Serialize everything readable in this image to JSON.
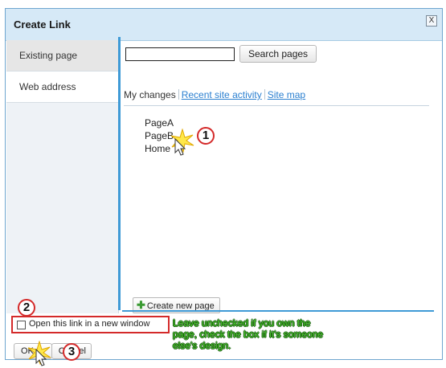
{
  "dialog": {
    "title": "Create Link",
    "close_label": "X"
  },
  "sidebar": {
    "items": [
      {
        "label": "Existing page"
      },
      {
        "label": "Web address"
      }
    ]
  },
  "search": {
    "input_value": "",
    "button_label": "Search pages"
  },
  "tabs": [
    {
      "label": "My changes"
    },
    {
      "label": "Recent site activity"
    },
    {
      "label": "Site map"
    }
  ],
  "pages": [
    {
      "label": "PageA"
    },
    {
      "label": "PageB"
    },
    {
      "label": "Home"
    }
  ],
  "create_page_label": "Create new page",
  "new_window_label": "Open this link in a new window",
  "new_window_checked": false,
  "annotation_note": "Leave unchecked if you own the page, check the box if it's someone else's design.",
  "footer": {
    "ok_label": "OK",
    "cancel_label": "Cancel"
  },
  "steps": {
    "one": "1",
    "two": "2",
    "three": "3"
  },
  "colors": {
    "accent": "#3f9ad6",
    "callout_red": "#d42a2a",
    "note_green": "#4bc62e",
    "link_blue": "#2a7fd0"
  }
}
